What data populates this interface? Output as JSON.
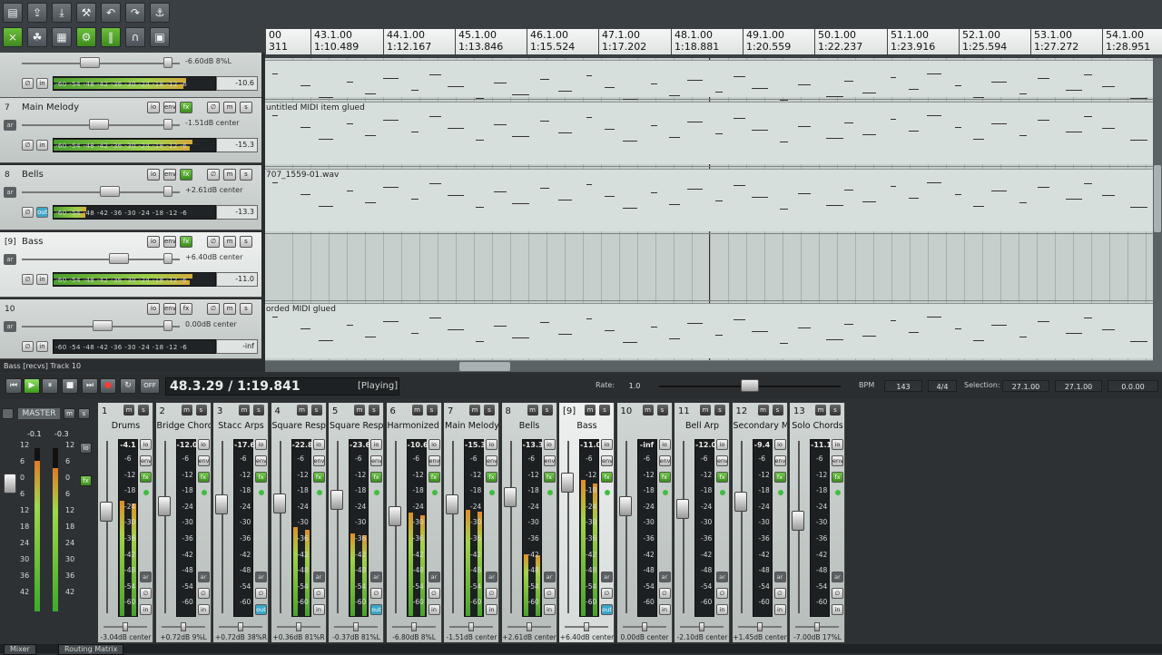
{
  "toolbar": {
    "row1": [
      {
        "name": "new-project-icon",
        "glyph": "▤"
      },
      {
        "name": "open-project-icon",
        "glyph": "⇪"
      },
      {
        "name": "save-project-icon",
        "glyph": "⤓"
      },
      {
        "name": "project-settings-icon",
        "glyph": "⚒"
      },
      {
        "name": "undo-icon",
        "glyph": "↶"
      },
      {
        "name": "redo-icon",
        "glyph": "↷"
      },
      {
        "name": "metronome-icon",
        "glyph": "⚓"
      }
    ],
    "row2": [
      {
        "name": "snap-icon",
        "glyph": "⨯"
      },
      {
        "name": "ripple-edit-icon",
        "glyph": "☘"
      },
      {
        "name": "grid-icon",
        "glyph": "▦"
      },
      {
        "name": "item-grouping-icon",
        "glyph": "⚙"
      },
      {
        "name": "auto-crossfade-icon",
        "glyph": "‖"
      },
      {
        "name": "envelope-points-icon",
        "glyph": "∩"
      },
      {
        "name": "lock-icon",
        "glyph": "▣"
      }
    ]
  },
  "ruler": [
    {
      "bar": "00",
      "time": "311"
    },
    {
      "bar": "43.1.00",
      "time": "1:10.489"
    },
    {
      "bar": "44.1.00",
      "time": "1:12.167"
    },
    {
      "bar": "45.1.00",
      "time": "1:13.846"
    },
    {
      "bar": "46.1.00",
      "time": "1:15.524"
    },
    {
      "bar": "47.1.00",
      "time": "1:17.202"
    },
    {
      "bar": "48.1.00",
      "time": "1:18.881"
    },
    {
      "bar": "49.1.00",
      "time": "1:20.559"
    },
    {
      "bar": "50.1.00",
      "time": "1:22.237"
    },
    {
      "bar": "51.1.00",
      "time": "1:23.916"
    },
    {
      "bar": "52.1.00",
      "time": "1:25.594"
    },
    {
      "bar": "53.1.00",
      "time": "1:27.272"
    },
    {
      "bar": "54.1.00",
      "time": "1:28.951"
    }
  ],
  "tracks": [
    {
      "num": "",
      "name": "",
      "vol": "-6.60dB 8%L",
      "peak": "-10.6",
      "meter": 0.82,
      "selected": false
    },
    {
      "num": "7",
      "name": "Main Melody",
      "vol": "-1.51dB center",
      "peak": "-15.3",
      "meter": 0.86,
      "selected": false
    },
    {
      "num": "8",
      "name": "Bells",
      "vol": "+2.61dB center",
      "peak": "-13.3",
      "meter": 0.2,
      "selected": false
    },
    {
      "num": "[9]",
      "name": "Bass",
      "vol": "+6.40dB center",
      "peak": "-11.0",
      "meter": 0.86,
      "selected": true
    },
    {
      "num": "10",
      "name": "",
      "vol": "0.00dB center",
      "peak": "-inf",
      "meter": 0.0,
      "selected": false
    }
  ],
  "track_buttons": {
    "io": "io",
    "env": "env",
    "fx": "fx",
    "mute": "m",
    "solo": "s",
    "arm": "ar",
    "in": "in",
    "out": "out",
    "phase": "∅"
  },
  "meter_scale": "-60 -54 -48 -42 -36 -30 -24 -18 -12  -6",
  "items": [
    {
      "label": ""
    },
    {
      "label": "untitled MIDI item glued"
    },
    {
      "label": "707_1559-01.wav"
    },
    {
      "label": ""
    },
    {
      "label": "orded MIDI glued"
    }
  ],
  "status_left": "Bass [recvs] Track 10",
  "transport": {
    "time": "48.3.29 / 1:19.841",
    "state": "[Playing]",
    "rate_label": "Rate:",
    "rate": "1.0",
    "bpm_label": "BPM",
    "bpm": "143",
    "timesig": "4/4",
    "selection_label": "Selection:",
    "sel_start": "27.1.00",
    "sel_end": "27.1.00",
    "sel_len": "0.0.00",
    "off": "OFF"
  },
  "master": {
    "title": "MASTER",
    "peak_l": "-0.1",
    "peak_r": "-0.3",
    "scale": [
      "12",
      "6",
      "0",
      "6",
      "12",
      "18",
      "24",
      "30",
      "36",
      "42"
    ],
    "meter_l": 0.92,
    "meter_r": 0.88
  },
  "strip_scale": [
    "-6",
    "-12",
    "-18",
    "-24",
    "-30",
    "-36",
    "-42",
    "-48",
    "-54",
    "-60"
  ],
  "strips": [
    {
      "num": "1",
      "name": "Drums",
      "peak": "-4.1",
      "pan": "-3.04dB center",
      "meter": 0.78,
      "fader": 0.58
    },
    {
      "num": "2",
      "name": "Bridge Chords",
      "peak": "-12.0",
      "pan": "+0.72dB 9%L",
      "meter": 0.0,
      "fader": 0.62
    },
    {
      "num": "3",
      "name": "Stacc Arps",
      "peak": "-17.6",
      "pan": "+0.72dB 38%R",
      "meter": 0.0,
      "fader": 0.63
    },
    {
      "num": "4",
      "name": "Square Resp",
      "peak": "-22.8",
      "pan": "+0.36dB 81%R",
      "meter": 0.6,
      "fader": 0.64
    },
    {
      "num": "5",
      "name": "Square Resp",
      "peak": "-23.6",
      "pan": "-0.37dB 81%L",
      "meter": 0.56,
      "fader": 0.66
    },
    {
      "num": "6",
      "name": "Harmonized li",
      "peak": "-10.6",
      "pan": "-6.80dB 8%L",
      "meter": 0.7,
      "fader": 0.55
    },
    {
      "num": "7",
      "name": "Main Melody",
      "peak": "-15.3",
      "pan": "-1.51dB center",
      "meter": 0.72,
      "fader": 0.63
    },
    {
      "num": "8",
      "name": "Bells",
      "peak": "-13.3",
      "pan": "+2.61dB center",
      "meter": 0.42,
      "fader": 0.68
    },
    {
      "num": "[9]",
      "name": "Bass",
      "peak": "-11.0",
      "pan": "+6.40dB center",
      "meter": 0.92,
      "fader": 0.78
    },
    {
      "num": "10",
      "name": "",
      "peak": "-inf",
      "pan": "0.00dB center",
      "meter": 0.0,
      "fader": 0.62
    },
    {
      "num": "11",
      "name": "Bell Arp",
      "peak": "-12.0",
      "pan": "-2.10dB center",
      "meter": 0.0,
      "fader": 0.6
    },
    {
      "num": "12",
      "name": "Secondary M",
      "peak": "-9.4",
      "pan": "+1.45dB center",
      "meter": 0.0,
      "fader": 0.65
    },
    {
      "num": "13",
      "name": "Solo Chords",
      "peak": "-11.1",
      "pan": "-7.00dB 17%L",
      "meter": 0.0,
      "fader": 0.52
    }
  ],
  "dock_tabs": [
    "Mixer",
    "Routing Matrix"
  ],
  "colors": {
    "accent_green": "#5ab533",
    "selected_track": "#eef1f0",
    "item_bg": "#d7dfdc"
  }
}
